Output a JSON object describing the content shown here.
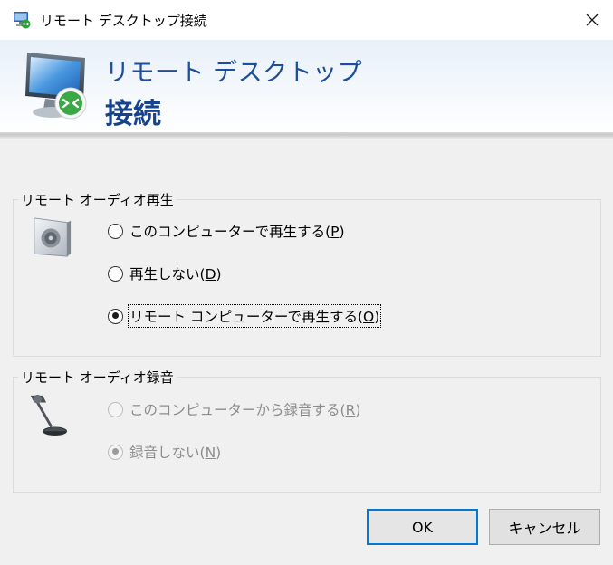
{
  "window": {
    "title": "リモート デスクトップ接続",
    "close_glyph": "✕"
  },
  "banner": {
    "line1": "リモート デスクトップ",
    "line2": "接続"
  },
  "playback_group": {
    "title": "リモート オーディオ再生",
    "options": [
      {
        "text": "このコンピューターで再生する(",
        "accel": "P",
        "tail": ")",
        "selected": false
      },
      {
        "text": "再生しない(",
        "accel": "D",
        "tail": ")",
        "selected": false
      },
      {
        "text": "リモート コンピューターで再生する(",
        "accel": "O",
        "tail": ")",
        "selected": true,
        "focused": true
      }
    ]
  },
  "recording_group": {
    "title": "リモート オーディオ録音",
    "disabled": true,
    "options": [
      {
        "text": "このコンピューターから録音する(",
        "accel": "R",
        "tail": ")",
        "selected": false
      },
      {
        "text": "録音しない(",
        "accel": "N",
        "tail": ")",
        "selected": true
      }
    ]
  },
  "buttons": {
    "ok": "OK",
    "cancel": "キャンセル"
  },
  "colors": {
    "accent": "#0078d7",
    "banner_text": "#1d4e9a",
    "window_bg": "#f0f0f0"
  },
  "icons": {
    "app": "remote-desktop-icon",
    "speaker": "speaker-icon",
    "microphone": "microphone-icon"
  }
}
